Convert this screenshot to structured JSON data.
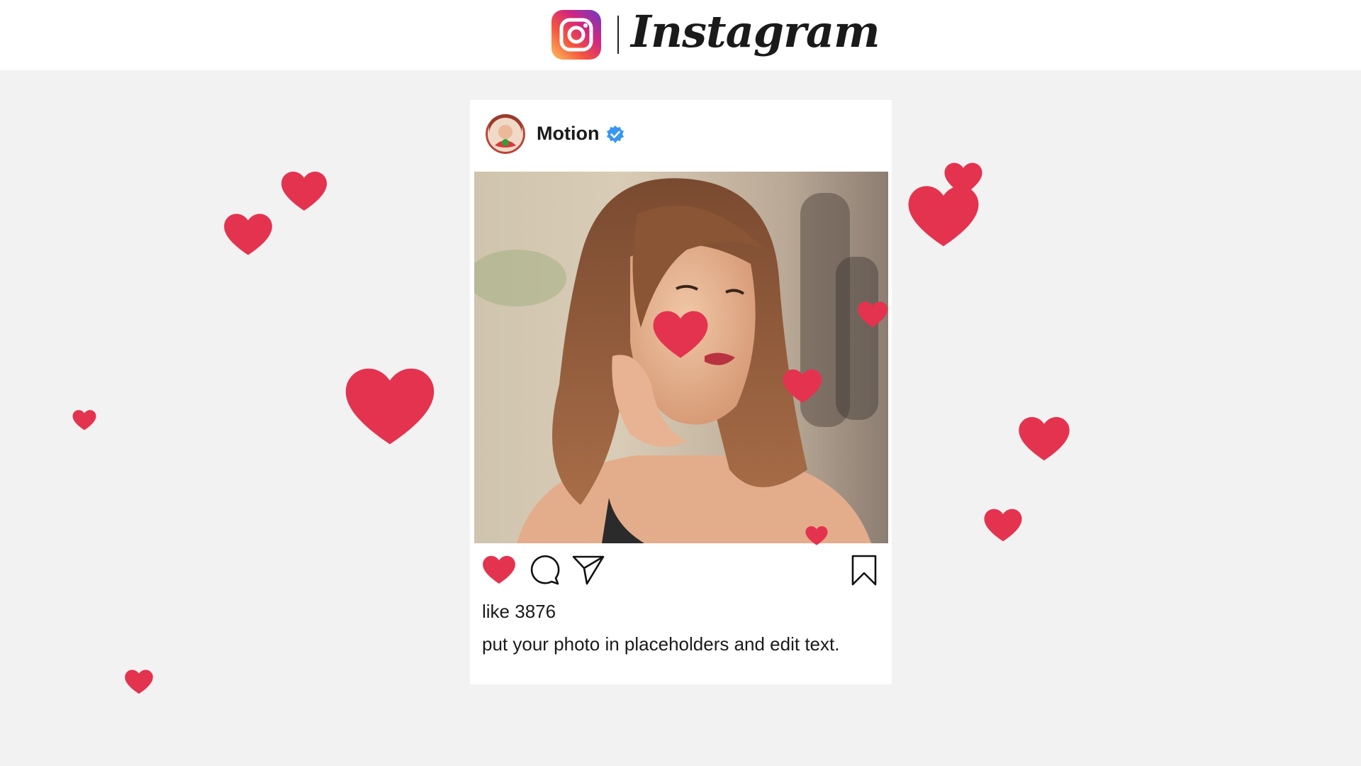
{
  "app": {
    "title": "Instagram"
  },
  "colors": {
    "heart": "#e4334f",
    "verified": "#3897f0",
    "background": "#f3f2f2"
  },
  "post": {
    "username": "Motion",
    "verified": true,
    "liked": true,
    "likes_text": "like 3876",
    "caption": "put your photo in placeholders and edit text."
  },
  "icons": {
    "logo": "instagram-camera-icon",
    "like": "heart-icon",
    "comment": "comment-bubble-icon",
    "share": "paper-plane-icon",
    "save": "bookmark-icon",
    "badge": "verified-badge-icon"
  }
}
